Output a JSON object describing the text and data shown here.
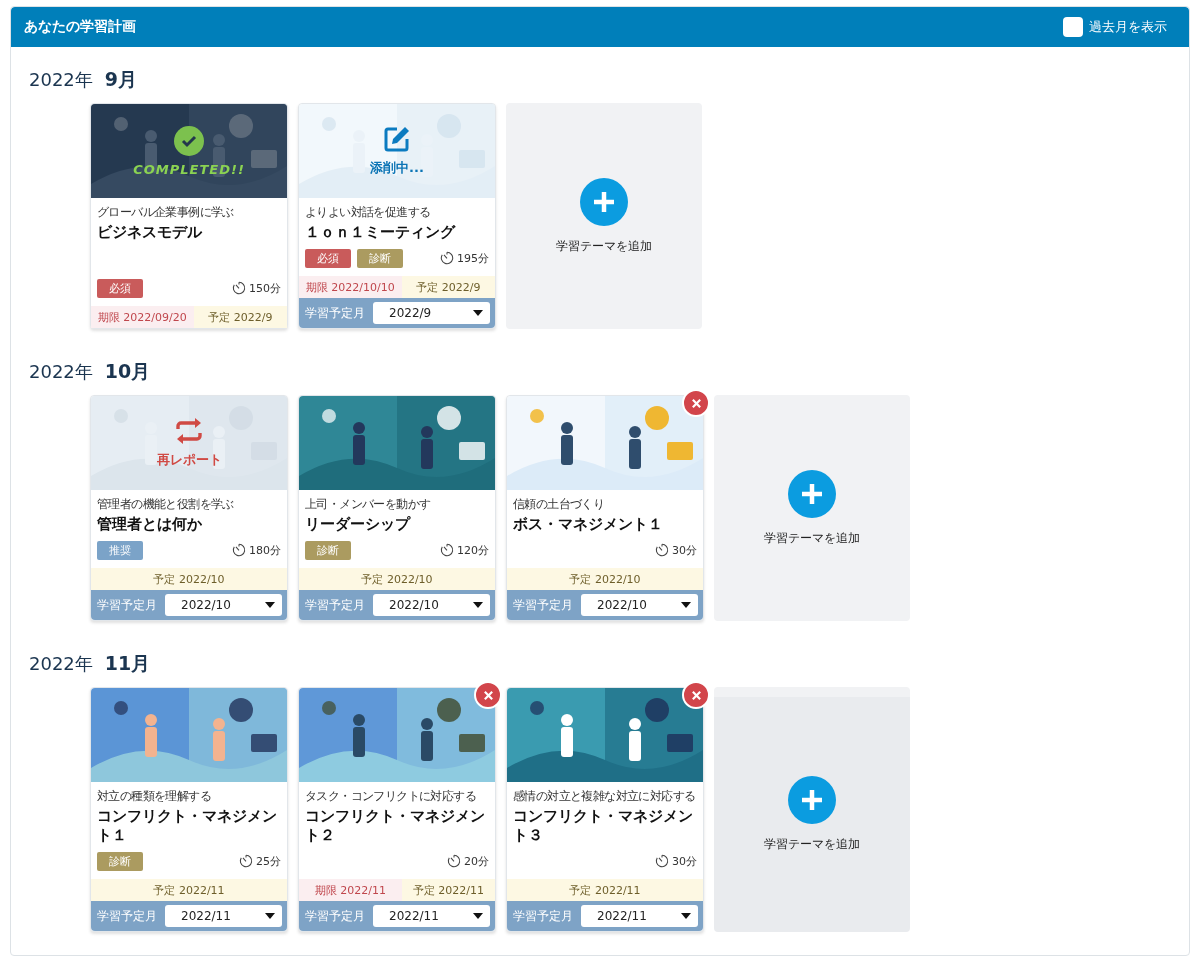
{
  "header": {
    "title": "あなたの学習計画",
    "show_past": {
      "label": "過去月を表示",
      "checked": false
    }
  },
  "months": [
    {
      "year": "2022年",
      "month": "9月",
      "add_label": "学習テーマを追加",
      "cards": [
        {
          "status": {
            "kind": "completed",
            "label": "COMPLETED!!"
          },
          "subtitle": "グローバル企業事例に学ぶ",
          "title": "ビジネスモデル",
          "tags": [
            {
              "label": "必須",
              "kind": "required"
            }
          ],
          "duration": "150分",
          "deadline": "期限 2022/09/20",
          "planned": "予定 2022/9",
          "removable": false
        },
        {
          "status": {
            "kind": "correcting",
            "label": "添削中..."
          },
          "subtitle": "よりよい対話を促進する",
          "title": "１ｏｎ１ミーティング",
          "tags": [
            {
              "label": "必須",
              "kind": "required"
            },
            {
              "label": "診断",
              "kind": "diagnosis"
            }
          ],
          "duration": "195分",
          "deadline": "期限 2022/10/10",
          "planned": "予定 2022/9",
          "month_select": {
            "label": "学習予定月",
            "value": "2022/9"
          },
          "removable": false
        }
      ]
    },
    {
      "year": "2022年",
      "month": "10月",
      "add_label": "学習テーマを追加",
      "cards": [
        {
          "status": {
            "kind": "resubmit",
            "label": "再レポート"
          },
          "subtitle": "管理者の機能と役割を学ぶ",
          "title": "管理者とは何か",
          "tags": [
            {
              "label": "推奨",
              "kind": "recommended"
            }
          ],
          "duration": "180分",
          "planned": "予定 2022/10",
          "month_select": {
            "label": "学習予定月",
            "value": "2022/10"
          },
          "removable": false
        },
        {
          "subtitle": "上司・メンバーを動かす",
          "title": "リーダーシップ",
          "tags": [
            {
              "label": "診断",
              "kind": "diagnosis"
            }
          ],
          "duration": "120分",
          "planned": "予定 2022/10",
          "month_select": {
            "label": "学習予定月",
            "value": "2022/10"
          },
          "removable": false
        },
        {
          "subtitle": "信頼の土台づくり",
          "title": "ボス・マネジメント１",
          "duration": "30分",
          "planned": "予定 2022/10",
          "month_select": {
            "label": "学習予定月",
            "value": "2022/10"
          },
          "removable": true
        }
      ]
    },
    {
      "year": "2022年",
      "month": "11月",
      "add_label": "学習テーマを追加",
      "cards": [
        {
          "subtitle": "対立の種類を理解する",
          "title": "コンフリクト・マネジメント１",
          "tags": [
            {
              "label": "診断",
              "kind": "diagnosis"
            }
          ],
          "duration": "25分",
          "planned": "予定 2022/11",
          "month_select": {
            "label": "学習予定月",
            "value": "2022/11"
          },
          "removable": false
        },
        {
          "subtitle": "タスク・コンフリクトに対応する",
          "title": "コンフリクト・マネジメント２",
          "duration": "20分",
          "deadline": "期限 2022/11",
          "planned": "予定 2022/11",
          "month_select": {
            "label": "学習予定月",
            "value": "2022/11"
          },
          "removable": true
        },
        {
          "subtitle": "感情の対立と複雑な対立に対応する",
          "title": "コンフリクト・マネジメント３",
          "duration": "30分",
          "planned": "予定 2022/11",
          "month_select": {
            "label": "学習予定月",
            "value": "2022/11"
          },
          "removable": true
        }
      ]
    }
  ]
}
